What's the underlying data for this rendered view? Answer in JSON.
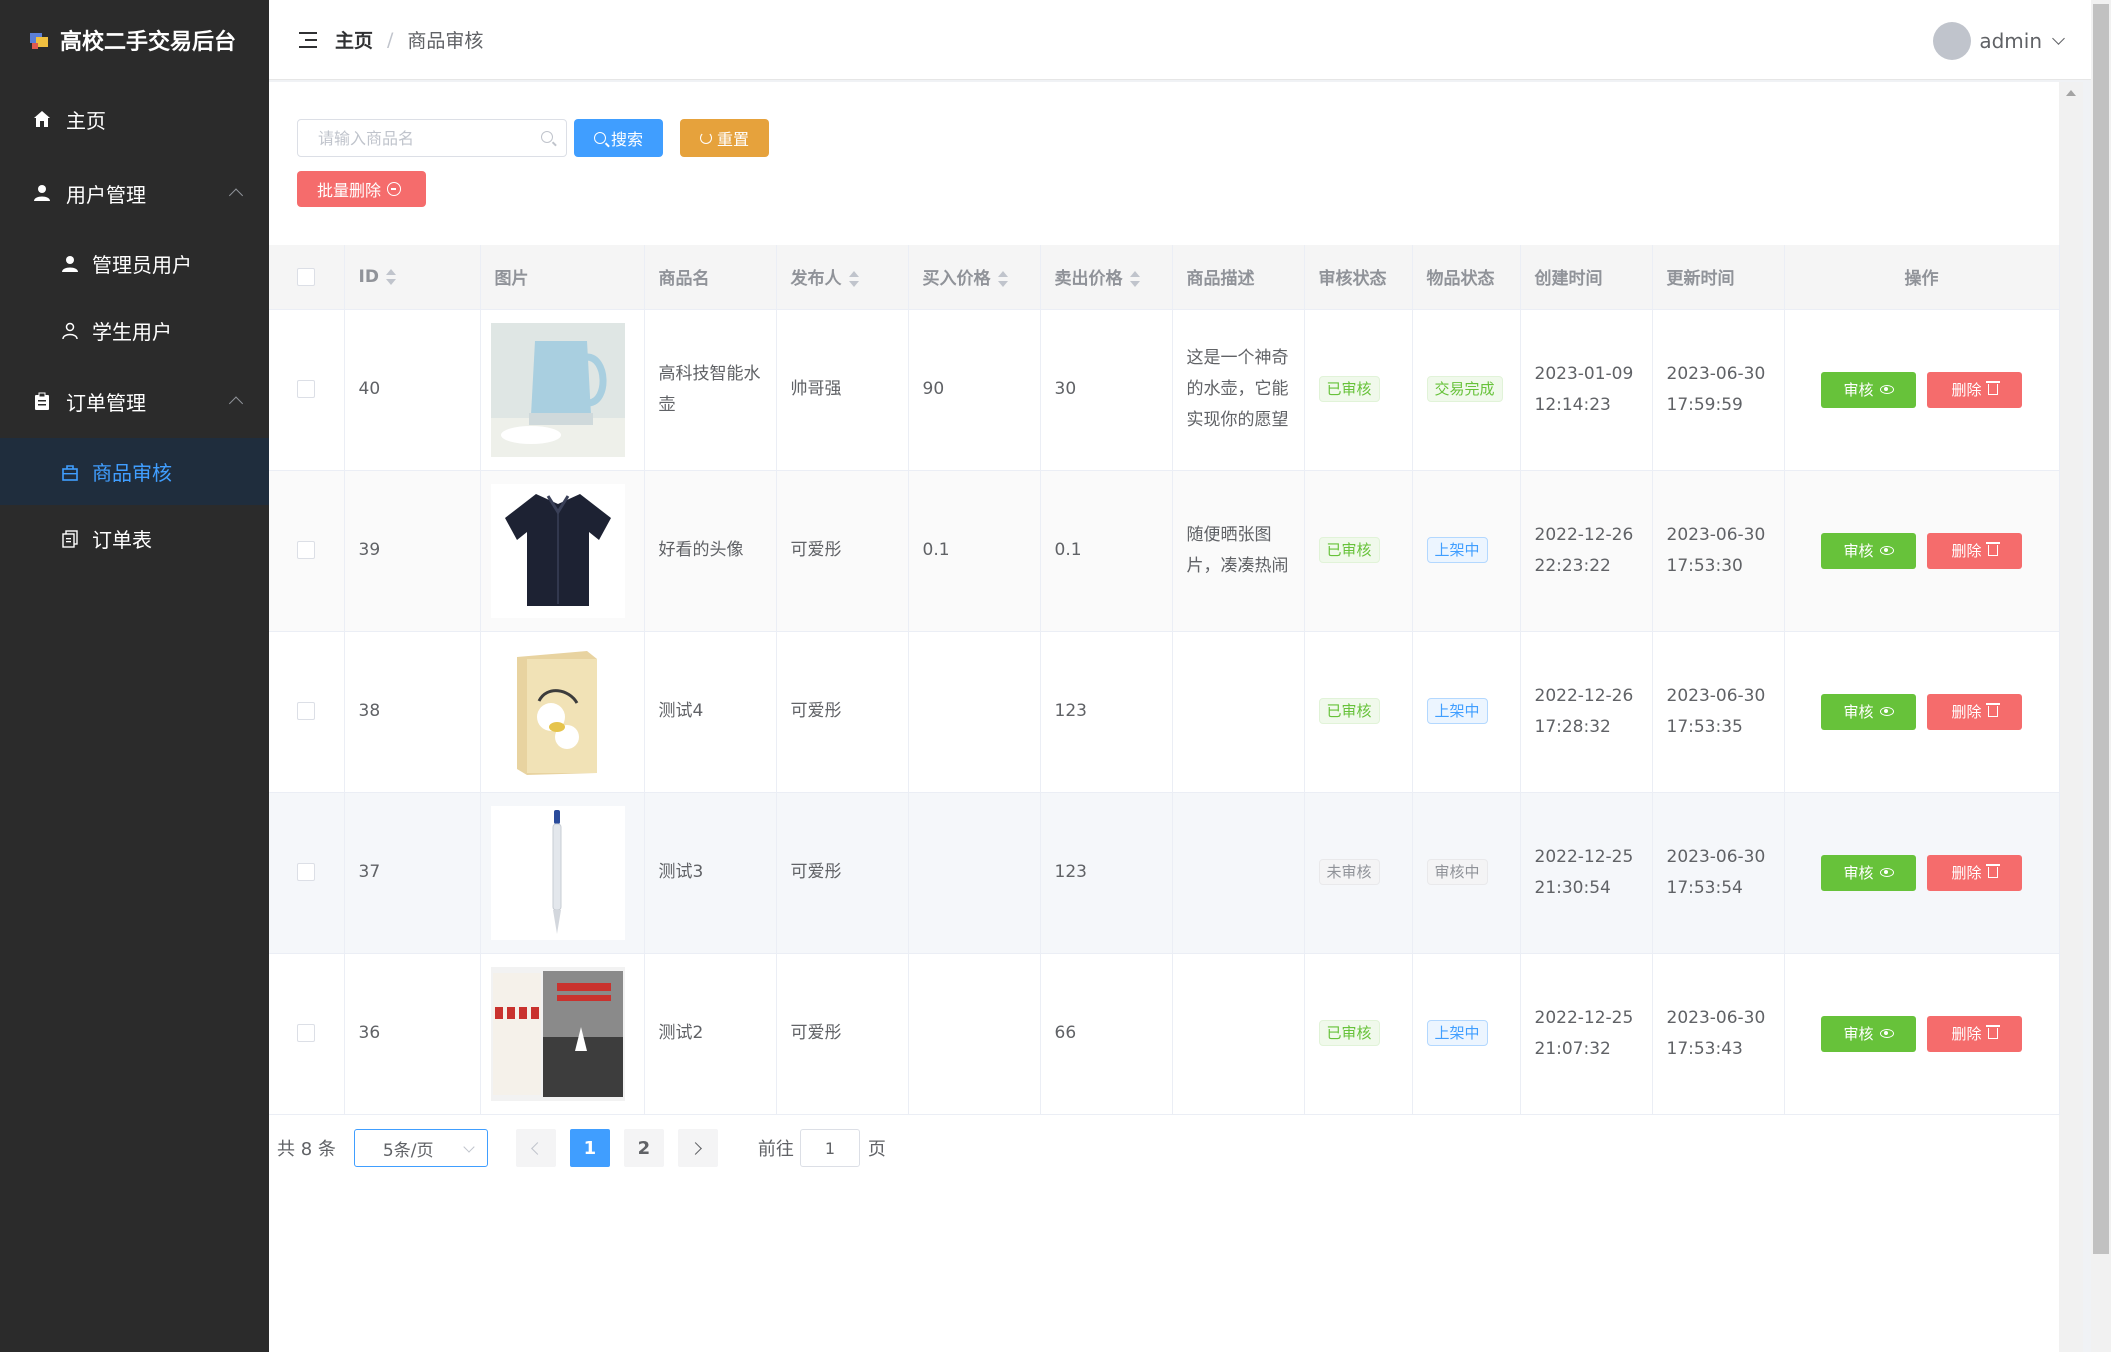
{
  "app": {
    "title": "高校二手交易后台"
  },
  "sidebar": {
    "items": [
      {
        "label": "主页",
        "icon": "home-icon"
      },
      {
        "label": "用户管理",
        "icon": "user-icon",
        "children": [
          {
            "label": "管理员用户",
            "icon": "user-filled-icon"
          },
          {
            "label": "学生用户",
            "icon": "user-outline-icon"
          }
        ]
      },
      {
        "label": "订单管理",
        "icon": "clipboard-icon",
        "children": [
          {
            "label": "商品审核",
            "icon": "shopping-bag-icon",
            "active": true
          },
          {
            "label": "订单表",
            "icon": "document-copy-icon"
          }
        ]
      }
    ]
  },
  "header": {
    "breadcrumb": {
      "home": "主页",
      "separator": "/",
      "current": "商品审核"
    },
    "user": {
      "name": "admin"
    }
  },
  "toolbar": {
    "search_placeholder": "请输入商品名",
    "search_value": "",
    "search_label": "搜索",
    "reset_label": "重置",
    "batch_delete_label": "批量删除"
  },
  "table": {
    "headers": {
      "id": "ID",
      "image": "图片",
      "name": "商品名",
      "publisher": "发布人",
      "buy_price": "买入价格",
      "sell_price": "卖出价格",
      "description": "商品描述",
      "audit_status": "审核状态",
      "item_status": "物品状态",
      "created": "创建时间",
      "updated": "更新时间",
      "actions": "操作"
    },
    "audit_label": "审核",
    "delete_label": "删除",
    "rows": [
      {
        "id": "40",
        "image": "kettle",
        "name": "高科技智能水壶",
        "publisher": "帅哥强",
        "buy_price": "90",
        "sell_price": "30",
        "description": "这是一个神奇的水壶，它能实现你的愿望",
        "audit_status": "已审核",
        "audit_type": "success",
        "item_status": "交易完成",
        "item_type": "success",
        "created": "2023-01-09 12:14:23",
        "updated": "2023-06-30 17:59:59"
      },
      {
        "id": "39",
        "image": "shirt",
        "name": "好看的头像",
        "publisher": "可爱彤",
        "buy_price": "0.1",
        "sell_price": "0.1",
        "description": "随便晒张图片，凑凑热闹",
        "audit_status": "已审核",
        "audit_type": "success",
        "item_status": "上架中",
        "item_type": "primary",
        "created": "2022-12-26 22:23:22",
        "updated": "2023-06-30 17:53:30"
      },
      {
        "id": "38",
        "image": "book-box",
        "name": "测试4",
        "publisher": "可爱彤",
        "buy_price": "",
        "sell_price": "123",
        "description": "",
        "audit_status": "已审核",
        "audit_type": "success",
        "item_status": "上架中",
        "item_type": "primary",
        "created": "2022-12-26 17:28:32",
        "updated": "2023-06-30 17:53:35"
      },
      {
        "id": "37",
        "image": "pen",
        "name": "测试3",
        "publisher": "可爱彤",
        "buy_price": "",
        "sell_price": "123",
        "description": "",
        "audit_status": "未审核",
        "audit_type": "info",
        "item_status": "审核中",
        "item_type": "info",
        "created": "2022-12-25 21:30:54",
        "updated": "2023-06-30 17:53:54"
      },
      {
        "id": "36",
        "image": "book-set",
        "name": "测试2",
        "publisher": "可爱彤",
        "buy_price": "",
        "sell_price": "66",
        "description": "",
        "audit_status": "已审核",
        "audit_type": "success",
        "item_status": "上架中",
        "item_type": "primary",
        "created": "2022-12-25 21:07:32",
        "updated": "2023-06-30 17:53:43"
      }
    ]
  },
  "pagination": {
    "total_label": "共 8 条",
    "page_size": "5条/页",
    "pages": [
      "1",
      "2"
    ],
    "current_page": "1",
    "goto_label": "前往",
    "goto_value": "1",
    "page_suffix": "页"
  },
  "colors": {
    "primary": "#409eff",
    "success": "#67c23a",
    "warning": "#e6a23c",
    "danger": "#f56c6c",
    "sidebar_bg": "#2b2b2b"
  }
}
